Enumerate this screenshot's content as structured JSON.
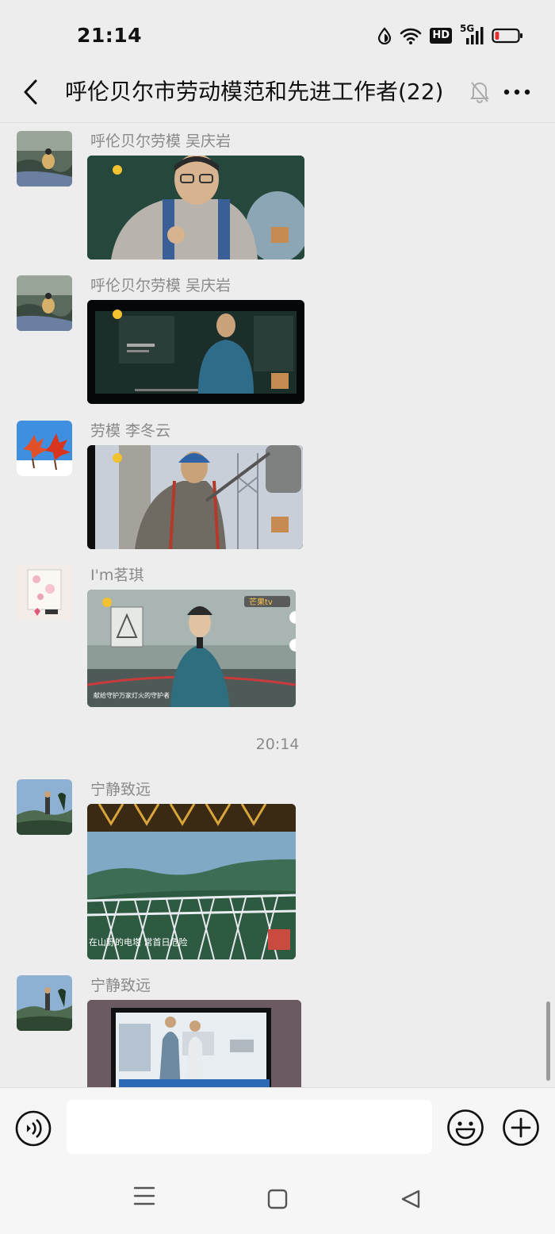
{
  "status_bar": {
    "time": "21:14",
    "network": "5G",
    "hd_label": "HD",
    "battery_level": 0.12,
    "icons": [
      "data-saver-icon",
      "wifi-icon",
      "hd-icon",
      "signal-5g-icon",
      "battery-icon"
    ]
  },
  "nav": {
    "title": "呼伦贝尔市劳动模范和先进工作者(22)",
    "back_icon": "chevron-left-icon",
    "mute_icon": "bell-off-icon",
    "more_icon": "more-dots-icon"
  },
  "messages": [
    {
      "sender": "呼伦贝尔劳模 吴庆岩",
      "type": "video",
      "avatar": "person-on-rock-avatar",
      "thumbnail": "man-in-hoodie-eating"
    },
    {
      "sender": "呼伦贝尔劳模 吴庆岩",
      "type": "video",
      "avatar": "person-on-rock-avatar",
      "thumbnail": "man-in-workwear-dark-stage"
    },
    {
      "sender": "劳模 李冬云",
      "type": "video",
      "avatar": "maple-leaves-avatar",
      "thumbnail": "lineworker-on-tower"
    },
    {
      "sender": "I'm茗琪",
      "type": "video",
      "avatar": "flower-card-avatar",
      "thumbnail": "singer-on-stage",
      "caption": "献给守护万家灯火的守护者",
      "badge": "芒果tv"
    },
    {
      "sender": "宁静致远",
      "type": "video",
      "avatar": "mountain-hiker-avatar",
      "thumbnail": "transmission-tower-forest",
      "caption": "在山野的电塔 常首日危险"
    },
    {
      "sender": "宁静致远",
      "type": "video",
      "avatar": "mountain-hiker-avatar",
      "thumbnail": "workers-in-control-room"
    }
  ],
  "time_divider": "20:14",
  "input_bar": {
    "placeholder": "",
    "voice_icon": "voice-icon",
    "emoji_icon": "emoji-icon",
    "plus_icon": "plus-circle-icon"
  },
  "system_nav": {
    "menu_icon": "menu-lines-icon",
    "home_icon": "home-square-icon",
    "back_icon": "back-triangle-icon"
  },
  "colors": {
    "background": "#ededed",
    "sender_text": "#8a8a8a",
    "battery_low": "#e0312f"
  }
}
